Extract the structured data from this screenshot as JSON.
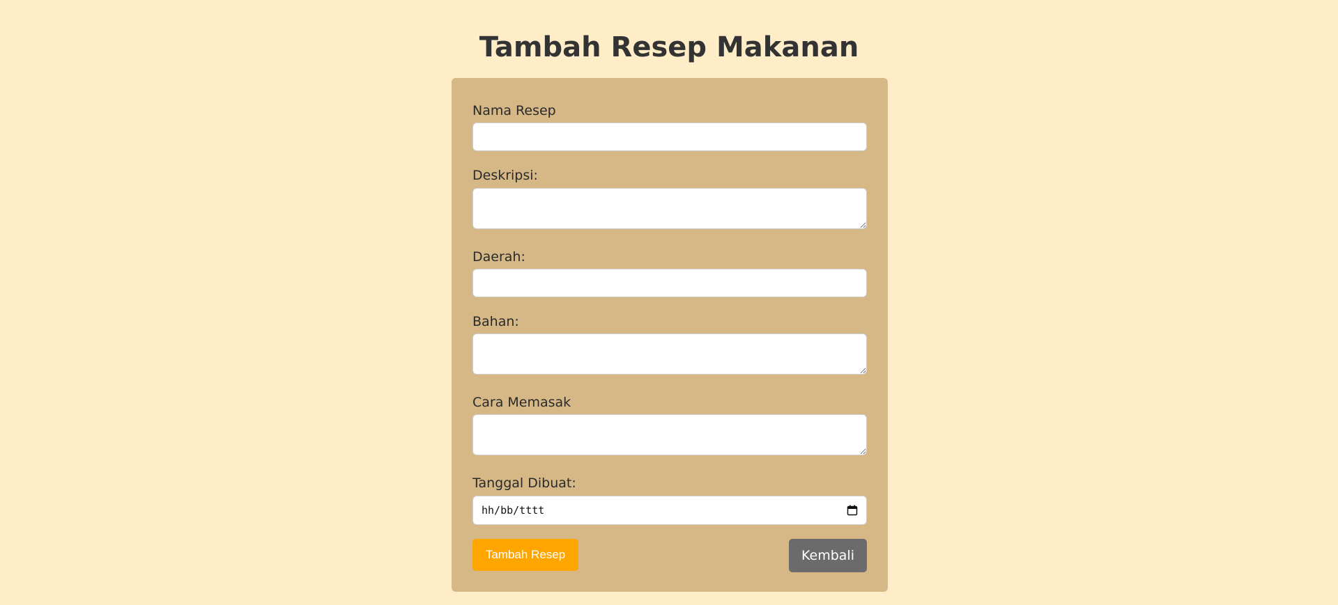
{
  "page": {
    "title": "Tambah Resep Makanan"
  },
  "form": {
    "fields": [
      {
        "label": "Nama Resep",
        "type": "text",
        "value": ""
      },
      {
        "label": "Deskripsi:",
        "type": "textarea",
        "value": ""
      },
      {
        "label": "Daerah:",
        "type": "text",
        "value": ""
      },
      {
        "label": "Bahan:",
        "type": "textarea",
        "value": ""
      },
      {
        "label": "Cara Memasak",
        "type": "textarea",
        "value": ""
      },
      {
        "label": "Tanggal Dibuat:",
        "type": "date",
        "placeholder": "hh/bb/tttt"
      }
    ],
    "submit_label": "Tambah Resep",
    "back_label": "Kembali"
  },
  "colors": {
    "background": "#ffedc8",
    "card": "#d6b887",
    "submit": "#ffa500",
    "back": "#6b6b6b"
  },
  "icons": {
    "date_picker": "calendar-icon"
  }
}
